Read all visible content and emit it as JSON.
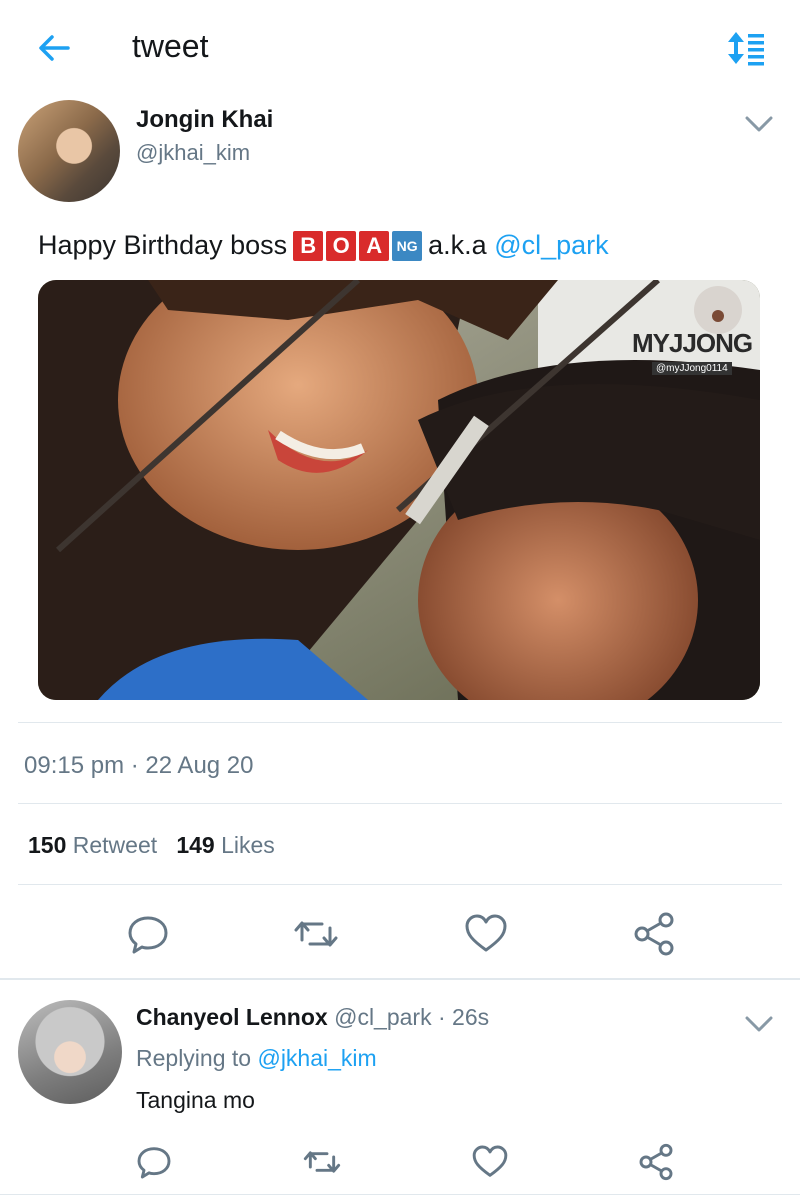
{
  "header": {
    "title": "tweet",
    "back_icon": "arrow-left-icon",
    "sort_icon": "sort-icon"
  },
  "tweet": {
    "author_name": "Jongin Khai",
    "author_handle": "@jkhai_kim",
    "text_prefix": "Happy Birthday boss",
    "emoji_letters": [
      "B",
      "O",
      "A",
      "NG"
    ],
    "text_middle": "a.k.a",
    "mention": "@cl_park",
    "watermark_title": "MYJJONG",
    "watermark_handle": "@myJJong0114",
    "timestamp": "09:15 pm · 22 Aug 20",
    "retweets_count": "150",
    "retweets_label": "Retweet",
    "likes_count": "149",
    "likes_label": "Likes",
    "actions": [
      "reply-icon",
      "retweet-icon",
      "like-icon",
      "share-icon"
    ]
  },
  "reply": {
    "author_name": "Chanyeol Lennox",
    "author_handle": "@cl_park",
    "time": "· 26s",
    "replying_label": "Replying to",
    "replying_handle": "@jkhai_kim",
    "text": "Tangina mo"
  },
  "colors": {
    "accent": "#1da1f2",
    "secondary_text": "#657786",
    "divider": "#e1e8ed"
  }
}
